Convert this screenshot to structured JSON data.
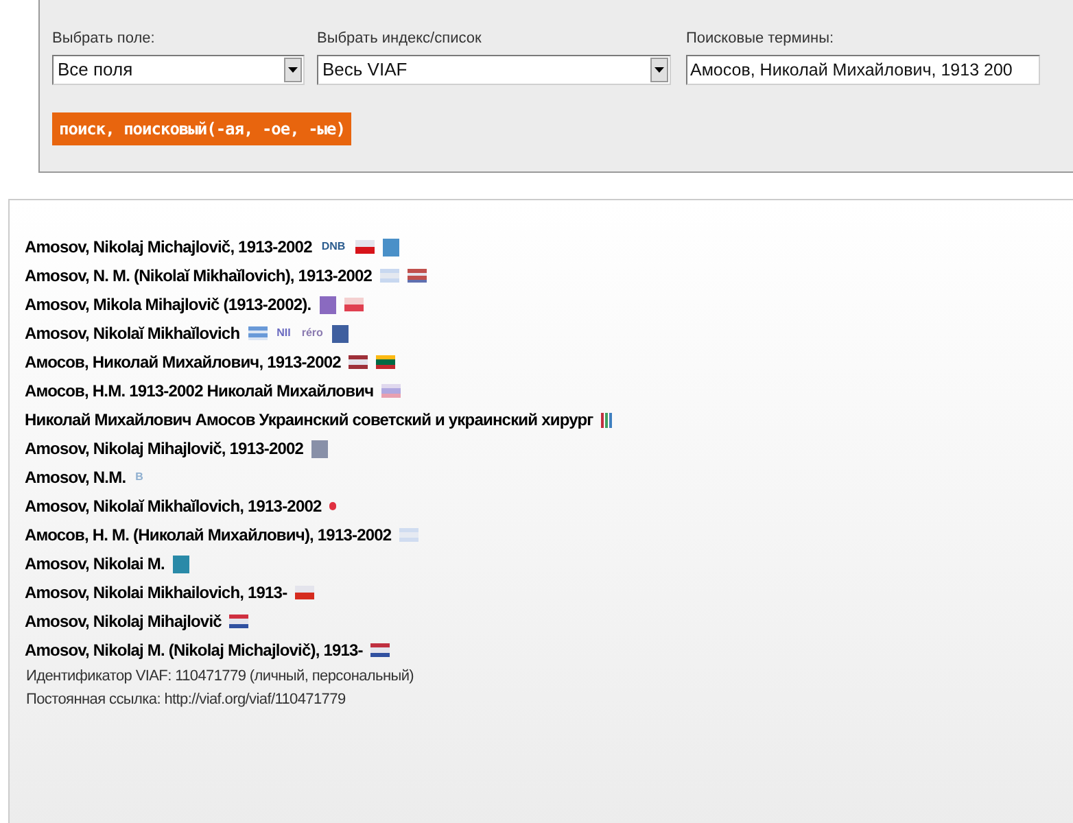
{
  "search_form": {
    "field_select": {
      "label": "Выбрать поле:",
      "value": "Все поля"
    },
    "index_select": {
      "label": "Выбрать индекс/список",
      "value": "Весь VIAF"
    },
    "terms": {
      "label": "Поисковые термины:",
      "value": "Амосов, Николай Михайлович, 1913 200"
    },
    "search_button": "поиск, поисковый(-ая, -ое, -ые)"
  },
  "headings": [
    {
      "text": "Amosov, Nikolaj Michajlovič, 1913-2002",
      "sources": [
        {
          "kind": "text",
          "label": "DNB",
          "color": "#2c5d8f"
        },
        {
          "kind": "flag",
          "stripes": [
            {
              "color": "#e4e4ec"
            },
            {
              "color": "#d7141a"
            }
          ]
        },
        {
          "kind": "block",
          "color": "#4a90c8"
        }
      ]
    },
    {
      "text": "Amosov, N. M. (Nikolaĭ Mikhaĭlovich), 1913-2002",
      "sources": [
        {
          "kind": "flag",
          "stripes": [
            {
              "color": "#c8d8f0"
            },
            {
              "color": "#e4e8f0"
            },
            {
              "color": "#c8d8f0"
            }
          ]
        },
        {
          "kind": "flag",
          "stripes": [
            {
              "color": "#c0504d"
            },
            {
              "color": "#e4e4ec"
            },
            {
              "color": "#c0504d"
            },
            {
              "color": "#6070b0"
            }
          ]
        }
      ]
    },
    {
      "text": "Amosov, Mikola Mihajlovič (1913-2002).",
      "sources": [
        {
          "kind": "block",
          "color": "#8a6ac0"
        },
        {
          "kind": "flag",
          "stripes": [
            {
              "color": "#f4d0d0"
            },
            {
              "color": "#e04050"
            }
          ]
        }
      ]
    },
    {
      "text": "Amosov, Nikolaĭ Mikhaĭlovich",
      "sources": [
        {
          "kind": "flag",
          "stripes": [
            {
              "color": "#6a9ad8"
            },
            {
              "color": "#dce6f4"
            },
            {
              "color": "#6a9ad8"
            },
            {
              "color": "#dce6f4"
            }
          ]
        },
        {
          "kind": "text",
          "label": "NII",
          "color": "#6a6ac0"
        },
        {
          "kind": "text",
          "label": "réro",
          "color": "#8a7ab0"
        },
        {
          "kind": "block",
          "color": "#3f5f9f"
        }
      ]
    },
    {
      "text": "Амосов, Николай Михайлович, 1913-2002",
      "sources": [
        {
          "kind": "flag",
          "stripes": [
            {
              "color": "#9e3039"
            },
            {
              "color": "#e4e4ec"
            },
            {
              "color": "#9e3039"
            }
          ]
        },
        {
          "kind": "flag",
          "stripes": [
            {
              "color": "#fdb913"
            },
            {
              "color": "#006a44"
            },
            {
              "color": "#c1272d"
            }
          ]
        }
      ]
    },
    {
      "text": "Амосов, Н.М. 1913-2002 Николай Михайлович",
      "sources": [
        {
          "kind": "flag",
          "stripes": [
            {
              "color": "#e0d8ee"
            },
            {
              "color": "#b0a8e0"
            },
            {
              "color": "#e8a0b0"
            }
          ]
        }
      ]
    },
    {
      "text": "Николай Михайлович Амосов Украинский советский и украинский хирург",
      "sources": [
        {
          "kind": "bars",
          "stripes": [
            {
              "color": "#c03040"
            },
            {
              "color": "#40a060"
            },
            {
              "color": "#4080c0"
            }
          ]
        }
      ]
    },
    {
      "text": "Amosov, Nikolaj Mihajlovič, 1913-2002",
      "sources": [
        {
          "kind": "block",
          "color": "#8890a8"
        }
      ]
    },
    {
      "text": "Amosov, N.M.",
      "sources": [
        {
          "kind": "text",
          "label": "B",
          "color": "#90b0d0"
        }
      ]
    },
    {
      "text": "Amosov, Nikolaĭ Mikhaĭlovich, 1913-2002",
      "sources": [
        {
          "kind": "dot",
          "color": "#e03040"
        }
      ]
    },
    {
      "text": "Амосов, Н. М. (Николай Михайлович), 1913-2002",
      "sources": [
        {
          "kind": "flag",
          "stripes": [
            {
              "color": "#d0dcf0"
            },
            {
              "color": "#e6eaf2"
            },
            {
              "color": "#d0dcf0"
            }
          ]
        }
      ]
    },
    {
      "text": "Amosov, Nikolai M.",
      "sources": [
        {
          "kind": "block",
          "color": "#2a8aa8"
        }
      ]
    },
    {
      "text": "Amosov, Nikolai Mikhailovich, 1913-",
      "sources": [
        {
          "kind": "flag",
          "stripes": [
            {
              "color": "#e4e4ec"
            },
            {
              "color": "#d52b1e"
            }
          ]
        }
      ]
    },
    {
      "text": "Amosov, Nikolaj Mihajlovič",
      "sources": [
        {
          "kind": "flag",
          "stripes": [
            {
              "color": "#d03040"
            },
            {
              "color": "#e4e4ec"
            },
            {
              "color": "#3050a0"
            }
          ]
        }
      ]
    },
    {
      "text": "Amosov, Nikolaj M. (Nikolaj Michajlovič), 1913-",
      "sources": [
        {
          "kind": "flag",
          "stripes": [
            {
              "color": "#c03040"
            },
            {
              "color": "#e4e4ec"
            },
            {
              "color": "#3050a0"
            }
          ]
        }
      ]
    }
  ],
  "viaf_id": "Идентификатор VIAF: 110471779 (личный, персональный)",
  "permalink": "Постоянная ссылка: http://viaf.org/viaf/110471779"
}
